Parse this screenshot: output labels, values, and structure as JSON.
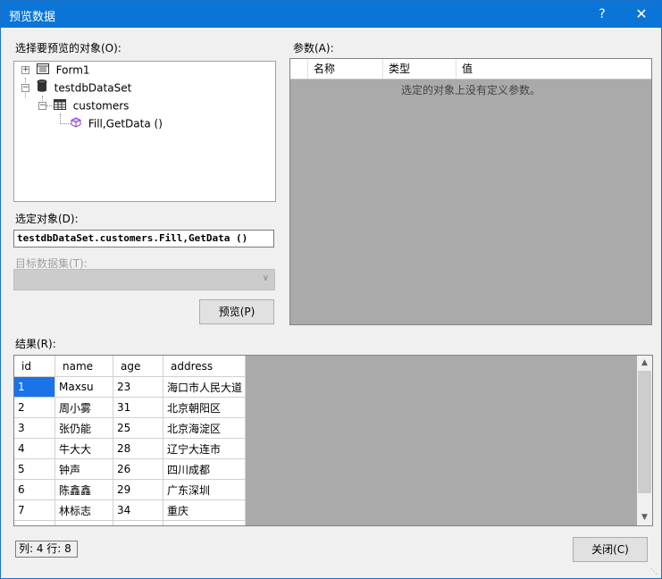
{
  "window": {
    "title": "预览数据",
    "help_glyph": "?",
    "close_glyph": "✕"
  },
  "labels": {
    "objects": "选择要预览的对象(O):",
    "params": "参数(A):",
    "selected_object": "选定对象(D):",
    "target_dataset": "目标数据集(T):",
    "results": "结果(R):"
  },
  "tree": {
    "nodes": [
      {
        "expander": "+",
        "label": "Form1",
        "icon": "form-icon"
      },
      {
        "expander": "−",
        "label": "testdbDataSet",
        "icon": "database-icon"
      },
      {
        "expander": "−",
        "label": "customers",
        "icon": "table-icon"
      },
      {
        "expander": "",
        "label": "Fill,GetData ()",
        "icon": "method-icon"
      }
    ]
  },
  "params": {
    "columns": [
      "名称",
      "类型",
      "值"
    ],
    "empty_text": "选定的对象上没有定义参数。"
  },
  "selected_object_value": "testdbDataSet.customers.Fill,GetData ()",
  "target_dataset_value": "",
  "buttons": {
    "preview": "预览(P)",
    "close": "关闭(C)"
  },
  "results": {
    "columns": [
      "id",
      "name",
      "age",
      "address"
    ],
    "rows": [
      [
        "1",
        "Maxsu",
        "23",
        "海口市人民大道"
      ],
      [
        "2",
        "周小雾",
        "31",
        "北京朝阳区"
      ],
      [
        "3",
        "张仍能",
        "25",
        "北京海淀区"
      ],
      [
        "4",
        "牛大大",
        "28",
        "辽宁大连市"
      ],
      [
        "5",
        "钟声",
        "26",
        "四川成都"
      ],
      [
        "6",
        "陈鑫鑫",
        "29",
        "广东深圳"
      ],
      [
        "7",
        "林标志",
        "34",
        "重庆"
      ]
    ]
  },
  "status": "列: 4  行: 8",
  "colors": {
    "titlebar": "#0a75d6",
    "selection": "#1a73e8",
    "dialog_bg": "#f0f0f0",
    "grid_empty": "#aaaaaa"
  }
}
